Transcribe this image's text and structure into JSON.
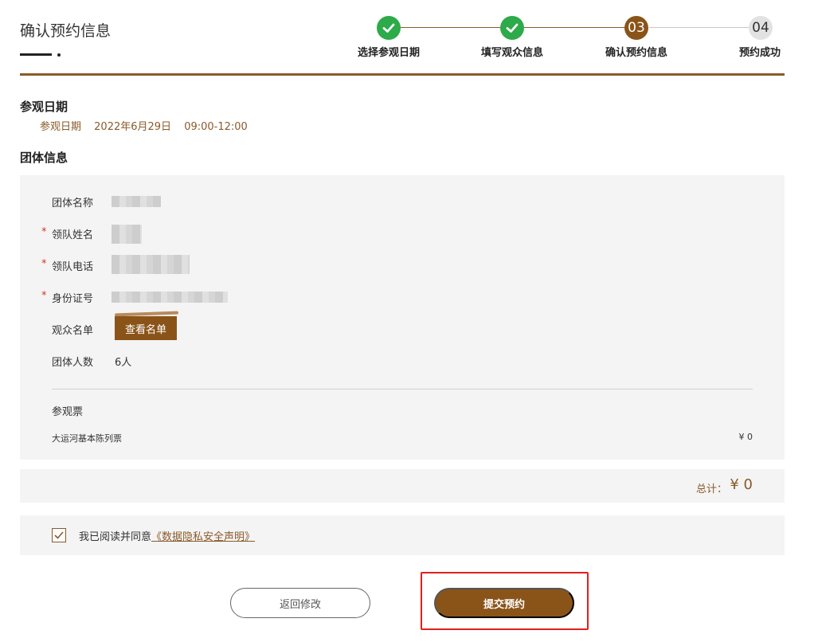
{
  "page": {
    "title": "确认预约信息"
  },
  "steps": [
    {
      "label": "选择参观日期",
      "status": "done",
      "number": "01"
    },
    {
      "label": "填写观众信息",
      "status": "done",
      "number": "02"
    },
    {
      "label": "确认预约信息",
      "status": "current",
      "number": "03"
    },
    {
      "label": "预约成功",
      "status": "todo",
      "number": "04"
    }
  ],
  "visit": {
    "heading": "参观日期",
    "label": "参观日期",
    "date": "2022年6月29日",
    "time": "09:00-12:00"
  },
  "group": {
    "heading": "团体信息",
    "fields": {
      "name_label": "团体名称",
      "leader_label": "领队姓名",
      "phone_label": "领队电话",
      "id_label": "身份证号",
      "audience_label": "观众名单",
      "count_label": "团体人数",
      "count_value": "6人",
      "required_mark": "*"
    },
    "view_list_button": "查看名单"
  },
  "tickets": {
    "heading": "参观票",
    "items": [
      {
        "name": "大运河基本陈列票",
        "price": "¥ 0"
      }
    ]
  },
  "total": {
    "label": "总计：",
    "value": "¥ 0"
  },
  "agreement": {
    "text": "我已阅读并同意",
    "link": "《数据隐私安全声明》",
    "checked": true
  },
  "actions": {
    "back_label": "返回修改",
    "submit_label": "提交预约"
  },
  "colors": {
    "brand": "#8a5419",
    "done": "#2daa49",
    "highlight": "#e0201c"
  }
}
